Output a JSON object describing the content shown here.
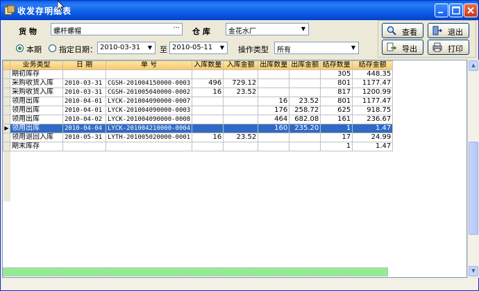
{
  "window": {
    "title": "收发存明细表"
  },
  "filters": {
    "goods_label": "货 物",
    "goods_value": "螺杆螺帽",
    "goods_ellipsis": "···",
    "warehouse_label": "仓 库",
    "warehouse_value": "金花水厂",
    "radio_current": "本期",
    "radio_date": "指定日期：",
    "date_from": "2010-03-31",
    "date_to_label": "至",
    "date_to": "2010-05-11",
    "op_type_label": "操作类型",
    "op_type_value": "所有"
  },
  "buttons": {
    "view": "查看",
    "exit": "退出",
    "export": "导出",
    "print": "打印"
  },
  "table": {
    "columns": [
      "业务类型",
      "日 期",
      "单 号",
      "入库数量",
      "入库金额",
      "出库数量",
      "出库金额",
      "结存数量",
      "结存金额"
    ],
    "rows": [
      [
        "期初库存",
        "",
        "",
        "",
        "",
        "",
        "",
        "305",
        "448.35"
      ],
      [
        "采购收货入库",
        "2010-03-31",
        "CGSH-201004150000-0003",
        "496",
        "729.12",
        "",
        "",
        "801",
        "1177.47"
      ],
      [
        "采购收货入库",
        "2010-03-31",
        "CGSH-201005040000-0002",
        "16",
        "23.52",
        "",
        "",
        "817",
        "1200.99"
      ],
      [
        "领用出库",
        "2010-04-01",
        "LYCK-201004090000-0007",
        "",
        "",
        "16",
        "23.52",
        "801",
        "1177.47"
      ],
      [
        "领用出库",
        "2010-04-01",
        "LYCK-201004090000-0003",
        "",
        "",
        "176",
        "258.72",
        "625",
        "918.75"
      ],
      [
        "领用出库",
        "2010-04-02",
        "LYCK-201004090000-0008",
        "",
        "",
        "464",
        "682.08",
        "161",
        "236.67"
      ],
      [
        "领用出库",
        "2010-04-04",
        "LYCK-201004210000-0004",
        "",
        "",
        "160",
        "235.20",
        "1",
        "1.47"
      ],
      [
        "领用退回入库",
        "2010-05-31",
        "LYTH-201005020000-0001",
        "16",
        "23.52",
        "",
        "",
        "17",
        "24.99"
      ],
      [
        "期末库存",
        "",
        "",
        "",
        "",
        "",
        "",
        "1",
        "1.47"
      ]
    ],
    "selected_row": 6,
    "selected_color": "#316ac5",
    "footer_color": "#90ee90",
    "header_color": "#f8c86c"
  }
}
